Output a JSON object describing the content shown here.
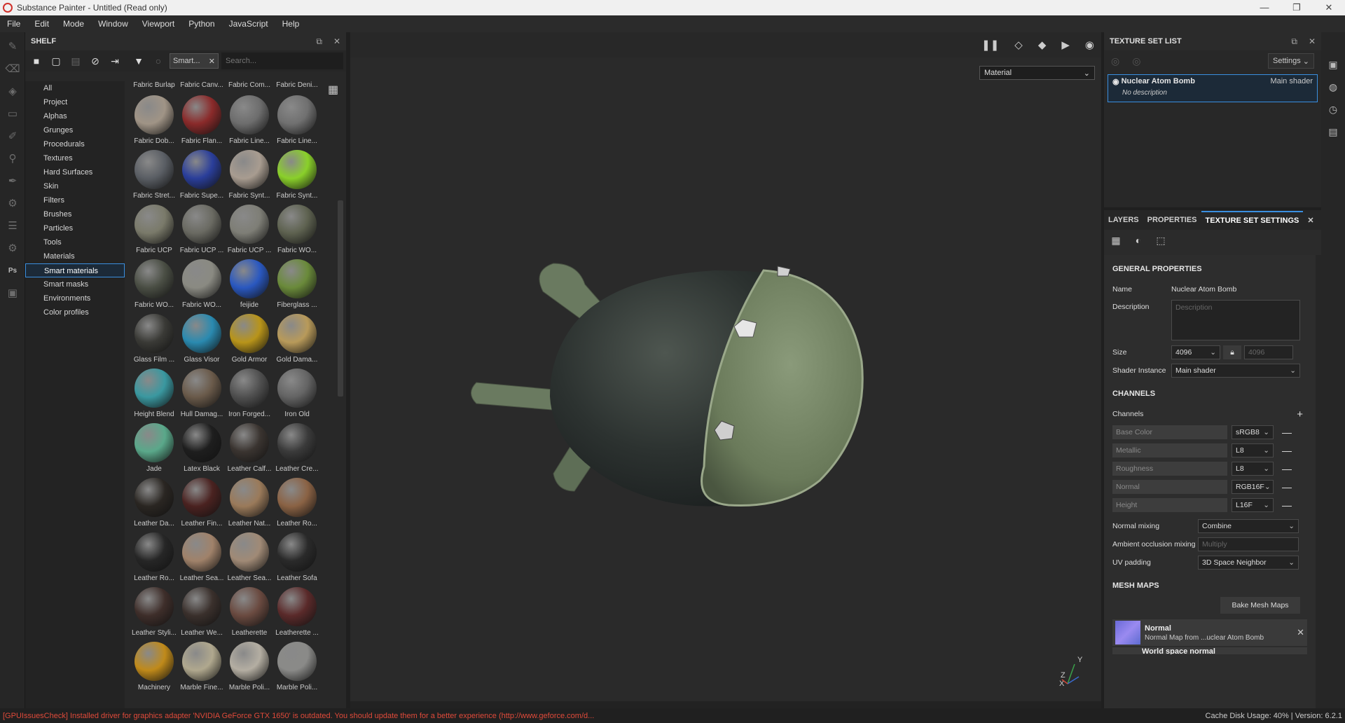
{
  "window": {
    "title": "Substance Painter - Untitled (Read only)",
    "minimize": "—",
    "restore": "❐",
    "close": "✕"
  },
  "menu": [
    "File",
    "Edit",
    "Mode",
    "Window",
    "Viewport",
    "Python",
    "JavaScript",
    "Help"
  ],
  "shelf": {
    "title": "SHELF",
    "filter_chip": "Smart...",
    "search_placeholder": "Search...",
    "categories": [
      "All",
      "Project",
      "Alphas",
      "Grunges",
      "Procedurals",
      "Textures",
      "Hard Surfaces",
      "Skin",
      "Filters",
      "Brushes",
      "Particles",
      "Tools",
      "Materials",
      "Smart materials",
      "Smart masks",
      "Environments",
      "Color profiles"
    ],
    "selected_category": "Smart materials",
    "top_labels": [
      "Fabric Burlap",
      "Fabric Canv...",
      "Fabric Com...",
      "Fabric Deni..."
    ],
    "materials": [
      {
        "name": "Fabric Dob...",
        "color": "#a09486"
      },
      {
        "name": "Fabric Flan...",
        "color": "#8a2a2a"
      },
      {
        "name": "Fabric Line...",
        "color": "#6d6d6d"
      },
      {
        "name": "Fabric Line...",
        "color": "#707070"
      },
      {
        "name": "Fabric Stret...",
        "color": "#5a5e64"
      },
      {
        "name": "Fabric Supe...",
        "color": "#2a3e9a"
      },
      {
        "name": "Fabric Synt...",
        "color": "#a89c90"
      },
      {
        "name": "Fabric Synt...",
        "color": "#8ad02a"
      },
      {
        "name": "Fabric UCP",
        "color": "#7a7a6a"
      },
      {
        "name": "Fabric UCP ...",
        "color": "#6a6a62"
      },
      {
        "name": "Fabric UCP ...",
        "color": "#7e7e76"
      },
      {
        "name": "Fabric WO...",
        "color": "#5e6250"
      },
      {
        "name": "Fabric WO...",
        "color": "#4a4e44"
      },
      {
        "name": "Fabric WO...",
        "color": "#8a8a82"
      },
      {
        "name": "feijide",
        "color": "#2a58c0"
      },
      {
        "name": "Fiberglass ...",
        "color": "#6a8a3a"
      },
      {
        "name": "Glass Film ...",
        "color": "#3a3a36"
      },
      {
        "name": "Glass Visor",
        "color": "#2a8ab0"
      },
      {
        "name": "Gold Armor",
        "color": "#b8941a"
      },
      {
        "name": "Gold Dama...",
        "color": "#b89a5a"
      },
      {
        "name": "Height Blend",
        "color": "#3a98a0"
      },
      {
        "name": "Hull Damag...",
        "color": "#6a5a4a"
      },
      {
        "name": "Iron Forged...",
        "color": "#505050"
      },
      {
        "name": "Iron Old",
        "color": "#646464"
      },
      {
        "name": "Jade",
        "color": "#5aa88a"
      },
      {
        "name": "Latex Black",
        "color": "#1e1e1e"
      },
      {
        "name": "Leather Calf...",
        "color": "#3a3430"
      },
      {
        "name": "Leather Cre...",
        "color": "#3a3a3a"
      },
      {
        "name": "Leather Da...",
        "color": "#2a2622"
      },
      {
        "name": "Leather Fin...",
        "color": "#4a2220"
      },
      {
        "name": "Leather Nat...",
        "color": "#9a7a5a"
      },
      {
        "name": "Leather Ro...",
        "color": "#8a6244"
      },
      {
        "name": "Leather Ro...",
        "color": "#262626"
      },
      {
        "name": "Leather Sea...",
        "color": "#a0826a"
      },
      {
        "name": "Leather Sea...",
        "color": "#a08a76"
      },
      {
        "name": "Leather Sofa",
        "color": "#2a2a2a"
      },
      {
        "name": "Leather Styli...",
        "color": "#3e2e2a"
      },
      {
        "name": "Leather We...",
        "color": "#3a302c"
      },
      {
        "name": "Leatherette",
        "color": "#6a4a40"
      },
      {
        "name": "Leatherette ...",
        "color": "#5a2a2a"
      },
      {
        "name": "Machinery",
        "color": "#c08a1a"
      },
      {
        "name": "Marble Fine...",
        "color": "#b0a88e"
      },
      {
        "name": "Marble Poli...",
        "color": "#b4aea2"
      },
      {
        "name": "Marble Poli...",
        "color": "#8a8a88"
      }
    ]
  },
  "viewport": {
    "material_mode": "Material",
    "axis_y": "Y",
    "axis_z": "Z",
    "axis_x": "X"
  },
  "texture_set_list": {
    "title": "TEXTURE SET LIST",
    "settings_label": "Settings",
    "item_name": "Nuclear Atom Bomb",
    "item_shader": "Main shader",
    "item_desc": "No description"
  },
  "tabs": [
    "LAYERS",
    "PROPERTIES",
    "TEXTURE SET SETTINGS"
  ],
  "active_tab": "TEXTURE SET SETTINGS",
  "tss": {
    "general_title": "GENERAL PROPERTIES",
    "name_label": "Name",
    "name_value": "Nuclear Atom Bomb",
    "desc_label": "Description",
    "desc_placeholder": "Description",
    "size_label": "Size",
    "size_value": "4096",
    "size_locked_value": "4096",
    "shader_label": "Shader Instance",
    "shader_value": "Main shader",
    "channels_title": "CHANNELS",
    "channels_label": "Channels",
    "channels": [
      {
        "name": "Base Color",
        "format": "sRGB8"
      },
      {
        "name": "Metallic",
        "format": "L8"
      },
      {
        "name": "Roughness",
        "format": "L8"
      },
      {
        "name": "Normal",
        "format": "RGB16F"
      },
      {
        "name": "Height",
        "format": "L16F"
      }
    ],
    "normal_mixing_label": "Normal mixing",
    "normal_mixing_value": "Combine",
    "ao_mixing_label": "Ambient occlusion mixing",
    "ao_mixing_value": "Multiply",
    "uv_padding_label": "UV padding",
    "uv_padding_value": "3D Space Neighbor",
    "mesh_maps_title": "MESH MAPS",
    "bake_label": "Bake Mesh Maps",
    "mesh_map_name": "Normal",
    "mesh_map_desc": "Normal Map from ...uclear Atom Bomb",
    "mesh_map2_name": "World space normal"
  },
  "status": {
    "warning": "[GPUIssuesCheck] Installed driver for graphics adapter 'NVIDIA GeForce GTX 1650' is outdated. You should update them for a better experience (http://www.geforce.com/d...",
    "cache": "Cache Disk Usage:    40% | Version: 6.2.1"
  },
  "colors": {
    "accent": "#3a8fe0",
    "warning": "#e04a3a"
  }
}
